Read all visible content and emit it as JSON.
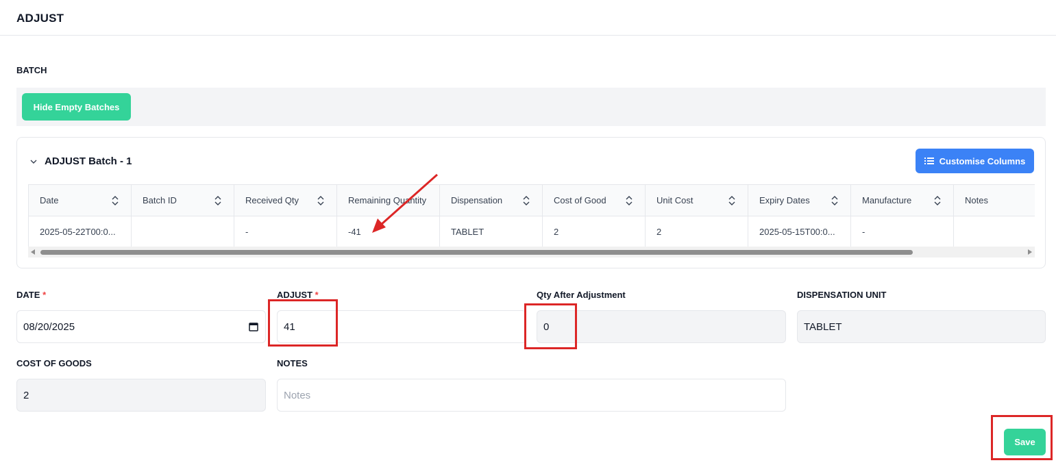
{
  "header": {
    "title": "ADJUST"
  },
  "batch_section": {
    "label": "BATCH",
    "hide_empty_label": "Hide Empty Batches",
    "card_title": "ADJUST Batch - 1",
    "customise_label": "Customise Columns",
    "columns": [
      "Date",
      "Batch ID",
      "Received Qty",
      "Remaining Quantity",
      "Dispensation",
      "Cost of Good",
      "Unit Cost",
      "Expiry Dates",
      "Manufacture",
      "Notes"
    ],
    "rows": [
      [
        "2025-05-22T00:0...",
        "",
        "-",
        "-41",
        "TABLET",
        "2",
        "2",
        "2025-05-15T00:0...",
        "-",
        ""
      ]
    ]
  },
  "form": {
    "date_label": "DATE",
    "date_value": "08/20/2025",
    "adjust_label": "ADJUST",
    "adjust_value": "41",
    "qty_after_label": "Qty After Adjustment",
    "qty_after_value": "0",
    "dispensation_label": "DISPENSATION UNIT",
    "dispensation_value": "TABLET",
    "cost_label": "COST OF GOODS",
    "cost_value": "2",
    "notes_label": "NOTES",
    "notes_placeholder": "Notes",
    "required_mark": "*",
    "save_label": "Save"
  },
  "colors": {
    "green": "#34d399",
    "blue": "#3b82f6",
    "annotation_red": "#dc2626"
  },
  "icons": [
    "chevron-down-icon",
    "list-icon",
    "sort-icon",
    "calendar-icon",
    "arrow-annotation"
  ]
}
